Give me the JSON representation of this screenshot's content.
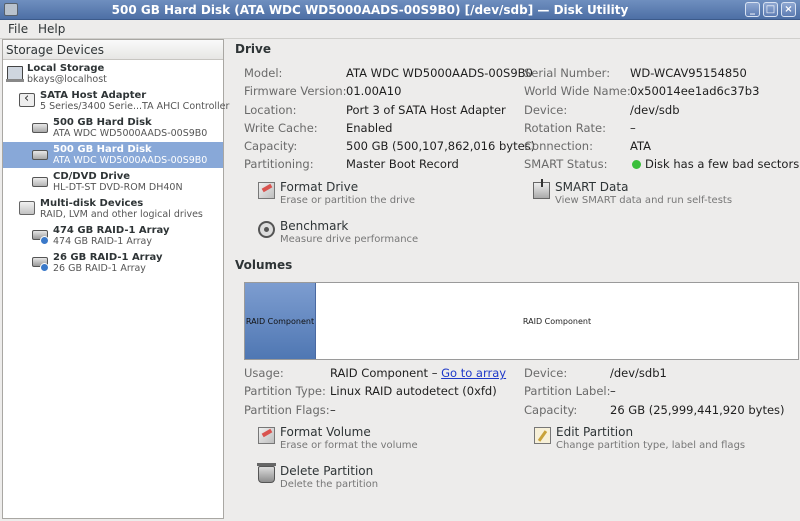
{
  "window": {
    "title": "500 GB Hard Disk (ATA WDC WD5000AADS-00S9B0) [/dev/sdb] — Disk Utility",
    "minimize_label": "_",
    "maximize_label": "□",
    "close_label": "×"
  },
  "menu": {
    "file": "File",
    "help": "Help"
  },
  "sidebar": {
    "header": "Storage Devices",
    "items": [
      {
        "title": "Local Storage",
        "subtitle": "bkays@localhost"
      },
      {
        "title": "SATA Host Adapter",
        "subtitle": "5 Series/3400 Serie...TA AHCI Controller"
      },
      {
        "title": "500 GB Hard Disk",
        "subtitle": "ATA WDC WD5000AADS-00S9B0"
      },
      {
        "title": "500 GB Hard Disk",
        "subtitle": "ATA WDC WD5000AADS-00S9B0"
      },
      {
        "title": "CD/DVD Drive",
        "subtitle": "HL-DT-ST DVD-ROM DH40N"
      },
      {
        "title": "Multi-disk Devices",
        "subtitle": "RAID, LVM and other logical drives"
      },
      {
        "title": "474 GB RAID-1 Array",
        "subtitle": "474 GB RAID-1 Array"
      },
      {
        "title": "26 GB RAID-1 Array",
        "subtitle": "26 GB RAID-1 Array"
      }
    ]
  },
  "drive": {
    "section_title": "Drive",
    "model_label": "Model:",
    "model": "ATA WDC WD5000AADS-00S9B0",
    "firmware_label": "Firmware Version:",
    "firmware": "01.00A10",
    "location_label": "Location:",
    "location": "Port 3 of SATA Host Adapter",
    "cache_label": "Write Cache:",
    "cache": "Enabled",
    "capacity_label": "Capacity:",
    "capacity": "500 GB (500,107,862,016 bytes)",
    "partitioning_label": "Partitioning:",
    "partitioning": "Master Boot Record",
    "serial_label": "Serial Number:",
    "serial": "WD-WCAV95154850",
    "wwn_label": "World Wide Name:",
    "wwn": "0x50014ee1ad6c37b3",
    "device_label": "Device:",
    "device": "/dev/sdb",
    "rotation_label": "Rotation Rate:",
    "rotation": "–",
    "connection_label": "Connection:",
    "connection": "ATA",
    "smart_label": "SMART Status:",
    "smart": "Disk has a few bad sectors",
    "smart_color": "#3bbf3b",
    "actions": {
      "format": {
        "name": "Format Drive",
        "desc": "Erase or partition the drive"
      },
      "smart": {
        "name": "SMART Data",
        "desc": "View SMART data and run self-tests"
      },
      "benchmark": {
        "name": "Benchmark",
        "desc": "Measure drive performance"
      }
    }
  },
  "volumes": {
    "section_title": "Volumes",
    "segments": [
      {
        "label": "RAID Component"
      },
      {
        "label": "RAID Component"
      }
    ],
    "usage_label": "Usage:",
    "usage": "RAID Component",
    "usage_sep": "–",
    "goto_array": "Go to array",
    "ptype_label": "Partition Type:",
    "ptype": "Linux RAID autodetect (0xfd)",
    "pflags_label": "Partition Flags:",
    "pflags": "–",
    "device_label": "Device:",
    "device": "/dev/sdb1",
    "plabel_label": "Partition Label:",
    "plabel": "–",
    "capacity_label": "Capacity:",
    "capacity": "26 GB (25,999,441,920 bytes)",
    "actions": {
      "format": {
        "name": "Format Volume",
        "desc": "Erase or format the volume"
      },
      "edit": {
        "name": "Edit Partition",
        "desc": "Change partition type, label and flags"
      },
      "delete": {
        "name": "Delete Partition",
        "desc": "Delete the partition"
      }
    }
  }
}
